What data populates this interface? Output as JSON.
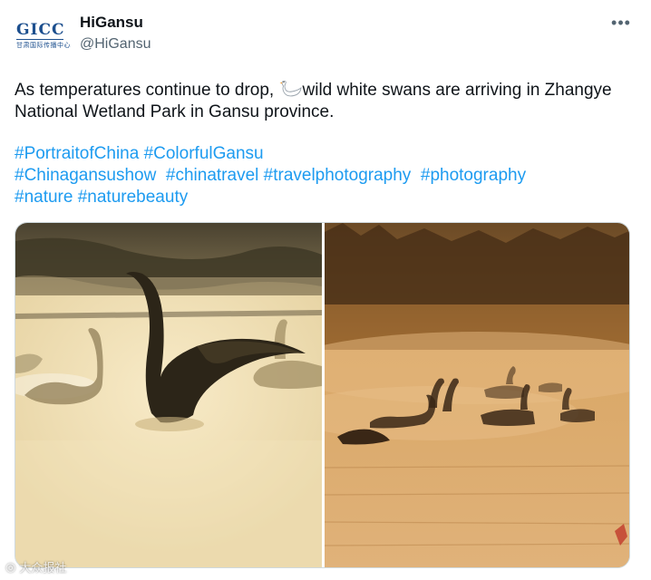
{
  "author": {
    "avatar_text": "GICC",
    "avatar_subtext": "甘肃国际传播中心",
    "display_name": "HiGansu",
    "handle": "@HiGansu"
  },
  "menu": {
    "more_icon": "more-dots-icon",
    "more_glyph": "•••"
  },
  "tweet": {
    "text_before_emoji": "As temperatures continue to drop, ",
    "emoji": "swan-emoji",
    "text_after_emoji": "wild white swans are arriving in Zhangye National Wetland Park in Gansu province.",
    "hashtags": [
      "#PortraitofChina",
      "#ColorfulGansu",
      "#Chinagansushow",
      "#chinatravel",
      "#travelphotography",
      "#photography",
      "#nature",
      "#naturebeauty"
    ]
  },
  "media": {
    "photos": [
      {
        "subject": "swan spreading wings in misty golden water"
      },
      {
        "subject": "flock of swans on foggy golden lake at sunrise"
      }
    ]
  },
  "watermark": {
    "icon": "dazhong-logo-icon",
    "text": "大众报社"
  },
  "colors": {
    "link": "#1d9bf0",
    "text": "#0f1419",
    "muted": "#536471",
    "border": "#cfd9de"
  }
}
